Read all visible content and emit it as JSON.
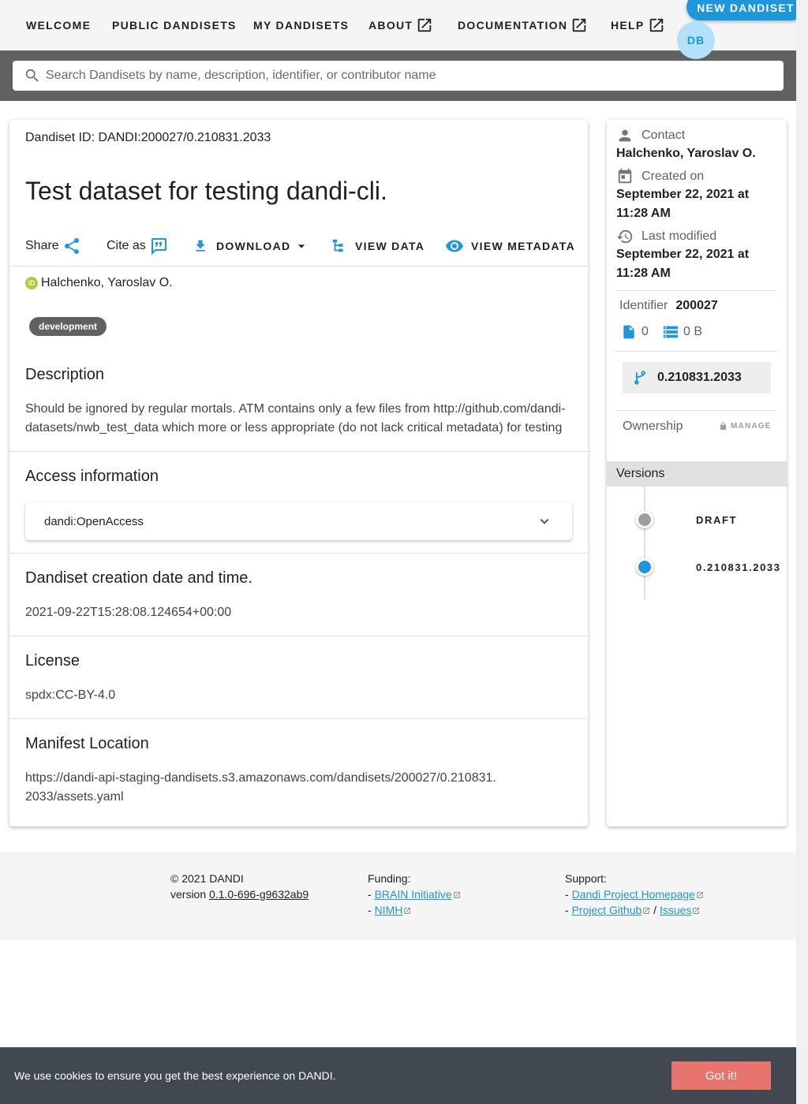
{
  "nav": {
    "welcome": "WELCOME",
    "public_dandisets": "PUBLIC DANDISETS",
    "my_dandisets": "MY DANDISETS",
    "about": "ABOUT",
    "documentation": "DOCUMENTATION",
    "help": "HELP",
    "new_dandiset": "NEW DANDISET",
    "avatar_initials": "DB"
  },
  "search": {
    "placeholder": "Search Dandisets by name, description, identifier, or contributor name"
  },
  "dandiset": {
    "id_line": "Dandiset ID: DANDI:200027/0.210831.2033",
    "title": "Test dataset for testing dandi-cli.",
    "actions": {
      "share": "Share",
      "cite_as": "Cite as",
      "download": "DOWNLOAD",
      "view_data": "VIEW DATA",
      "view_metadata": "VIEW METADATA"
    },
    "contributor": "Halchenko, Yaroslav O.",
    "keyword": "development",
    "description_title": "Description",
    "description_text": "Should be ignored by regular mortals. ATM contains only a few files from http://github.com/dandi-datasets/nwb_test_data which more or less appropriate (do not lack critical metadata) for testing",
    "access_title": "Access information",
    "access_value": "dandi:OpenAccess",
    "creation_title": "Dandiset creation date and time.",
    "creation_value": "2021-09-22T15:28:08.124654+00:00",
    "license_title": "License",
    "license_value": "spdx:CC-BY-4.0",
    "manifest_title": "Manifest Location",
    "manifest_value": "https://dandi-api-staging-dandisets.s3.amazonaws.com/dandisets/200027/0.210831.2033/assets.yaml"
  },
  "sidebar": {
    "contact_label": "Contact",
    "contact_value": "Halchenko, Yaroslav O.",
    "created_label": "Created on",
    "created_value": "September 22, 2021 at 11:28 AM",
    "modified_label": "Last modified",
    "modified_value": "September 22, 2021 at 11:28 AM",
    "identifier_label": "Identifier",
    "identifier_value": "200027",
    "file_count": "0",
    "size": "0 B",
    "current_version": "0.210831.2033",
    "ownership_label": "Ownership",
    "manage_label": "MANAGE",
    "versions_title": "Versions",
    "versions": [
      {
        "label": "DRAFT",
        "color": "#9e9e9e"
      },
      {
        "label": "0.210831.2033",
        "color": "#1e96db"
      }
    ]
  },
  "footer": {
    "copyright": "© 2021 DANDI",
    "version_prefix": "version ",
    "version": "0.1.0-696-g9632ab9",
    "funding_title": "Funding:",
    "funding_links": [
      "BRAIN Initiative",
      "NIMH"
    ],
    "support_title": "Support:",
    "support_links": [
      "Dandi Project Homepage",
      "Project Github",
      "Issues"
    ]
  },
  "cookie": {
    "text": "We use cookies to ensure you get the best experience on DANDI.",
    "button": "Got it!"
  },
  "colors": {
    "accent": "#1e96db",
    "appbar": "#f5f5f5",
    "searchbar": "#616161",
    "cookie_bg": "#424851",
    "cookie_button": "#e8746e"
  }
}
